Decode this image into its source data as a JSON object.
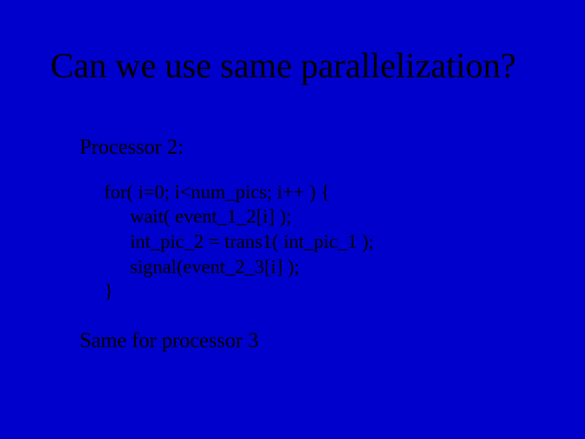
{
  "title": "Can we use same parallelization?",
  "subhead": "Processor 2:",
  "code": {
    "l1": "for( i=0; i<num_pics; i++ ) {",
    "l2": "wait( event_1_2[i] );",
    "l3": "int_pic_2 = trans1( int_pic_1 );",
    "l4": "signal(event_2_3[i] );",
    "l5": "}"
  },
  "footer": "Same for processor 3"
}
